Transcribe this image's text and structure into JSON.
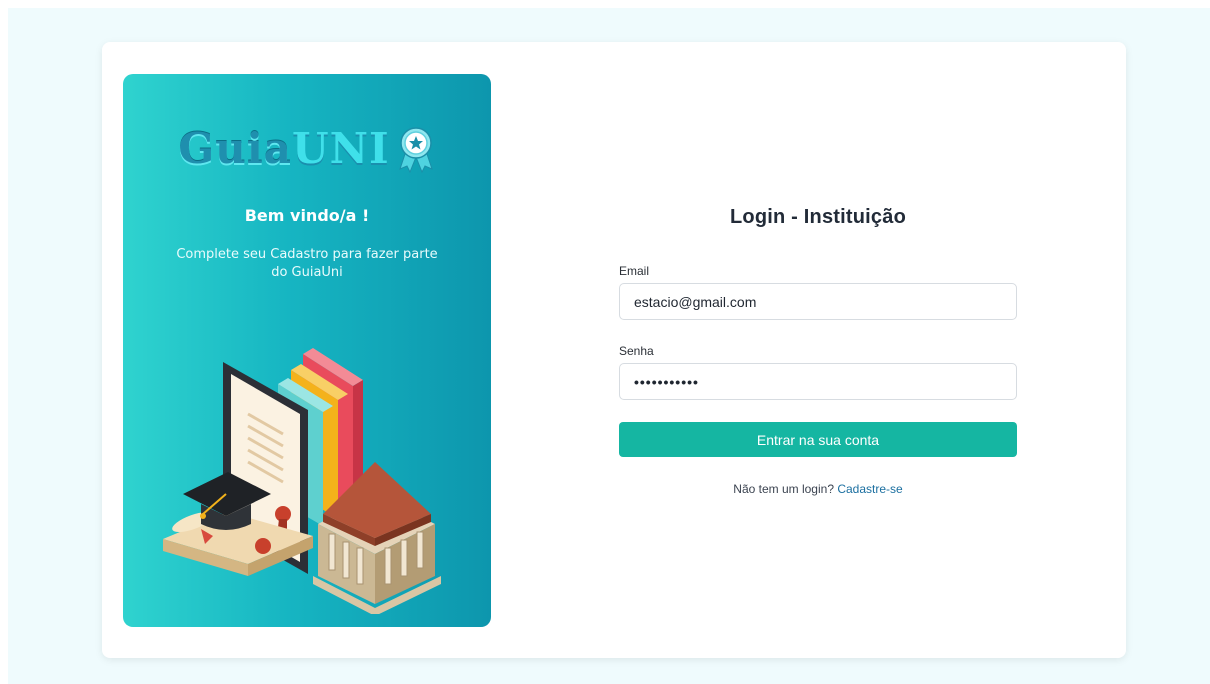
{
  "welcome_panel": {
    "brand_guia": "Guia",
    "brand_uni": "UNI",
    "title": "Bem vindo/a !",
    "subtitle": "Complete seu Cadastro para fazer parte do GuiaUni"
  },
  "login": {
    "title": "Login - Instituição",
    "email_label": "Email",
    "email_value": "estacio@gmail.com",
    "password_label": "Senha",
    "password_value": "•••••••••••",
    "submit_label": "Entrar na sua conta",
    "signup_prompt": "Não tem um login?",
    "signup_link": "Cadastre-se"
  },
  "colors": {
    "primary": "#15b6a2",
    "panel_start": "#2fd3cf",
    "panel_end": "#0d96ad",
    "link": "#1b6fa0",
    "page_bg": "#effbfd"
  },
  "icons": [
    "award-ribbon-icon",
    "education-illustration"
  ]
}
